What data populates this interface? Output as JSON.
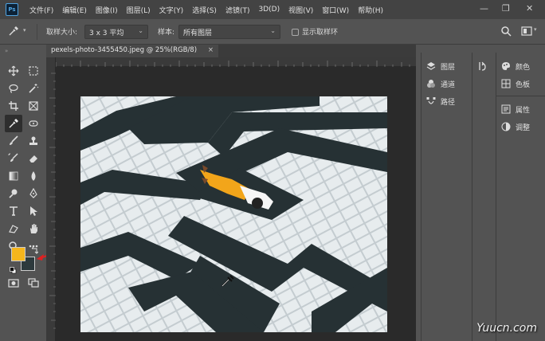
{
  "app": {
    "logo": "Ps"
  },
  "menu": {
    "items": [
      "文件(F)",
      "编辑(E)",
      "图像(I)",
      "图层(L)",
      "文字(Y)",
      "选择(S)",
      "滤镜(T)",
      "3D(D)",
      "视图(V)",
      "窗口(W)",
      "帮助(H)"
    ]
  },
  "window_controls": {
    "minimize": "—",
    "restore": "❐",
    "close": "✕"
  },
  "options": {
    "sample_size_label": "取样大小:",
    "sample_size_value": "3 x 3 平均",
    "sample_label": "样本:",
    "sample_value": "所有图层",
    "show_ring_label": "显示取样环"
  },
  "document": {
    "tab_title": "pexels-photo-3455450.jpeg @ 25%(RGB/8)",
    "tab_close": "×"
  },
  "colors": {
    "foreground": "#f6b61c",
    "background": "#2d3a3d",
    "annotation_arrow": "#e02020"
  },
  "panels": {
    "left_group": [
      {
        "icon": "layers-icon",
        "label": "图层"
      },
      {
        "icon": "channels-icon",
        "label": "通道"
      },
      {
        "icon": "paths-icon",
        "label": "路径"
      }
    ],
    "right_group_top": [
      {
        "icon": "color-icon",
        "label": "颜色"
      },
      {
        "icon": "swatches-icon",
        "label": "色板"
      }
    ],
    "right_group_bottom": [
      {
        "icon": "properties-icon",
        "label": "属性"
      },
      {
        "icon": "adjustments-icon",
        "label": "调整"
      }
    ]
  },
  "watermark": "Yuucn.com"
}
